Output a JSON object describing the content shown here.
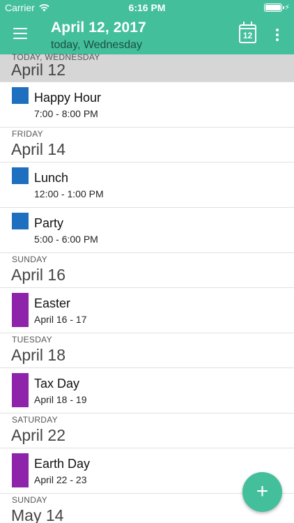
{
  "status": {
    "carrier": "Carrier",
    "time": "6:16 PM",
    "icons": [
      "wifi-icon",
      "battery-icon",
      "charging-icon"
    ]
  },
  "appbar": {
    "title": "April 12, 2017",
    "subtitle": "today, Wednesday",
    "calendar_day": "12",
    "background": "#43bf9c",
    "icons": [
      "menu-icon",
      "calendar-today-icon",
      "more-vertical-icon"
    ]
  },
  "agenda": [
    {
      "dow": "TODAY, WEDNESDAY",
      "date": "April 12",
      "events": [
        {
          "title": "Happy Hour",
          "time": "7:00 - 8:00 PM",
          "color": "#1f6fc0"
        }
      ]
    },
    {
      "dow": "FRIDAY",
      "date": "April 14",
      "events": [
        {
          "title": "Lunch",
          "time": "12:00 - 1:00 PM",
          "color": "#1f6fc0"
        },
        {
          "title": "Party",
          "time": "5:00 - 6:00 PM",
          "color": "#1f6fc0"
        }
      ]
    },
    {
      "dow": "SUNDAY",
      "date": "April 16",
      "events": [
        {
          "title": "Easter",
          "time": "April 16 - 17",
          "color": "#8e24aa"
        }
      ]
    },
    {
      "dow": "TUESDAY",
      "date": "April 18",
      "events": [
        {
          "title": "Tax Day",
          "time": "April 18 - 19",
          "color": "#8e24aa"
        }
      ]
    },
    {
      "dow": "SATURDAY",
      "date": "April 22",
      "events": [
        {
          "title": "Earth Day",
          "time": "April 22 - 23",
          "color": "#8e24aa"
        }
      ]
    },
    {
      "dow": "SUNDAY",
      "date": "May 14",
      "events": []
    }
  ],
  "fab": {
    "label": "+",
    "icon": "add-icon"
  }
}
